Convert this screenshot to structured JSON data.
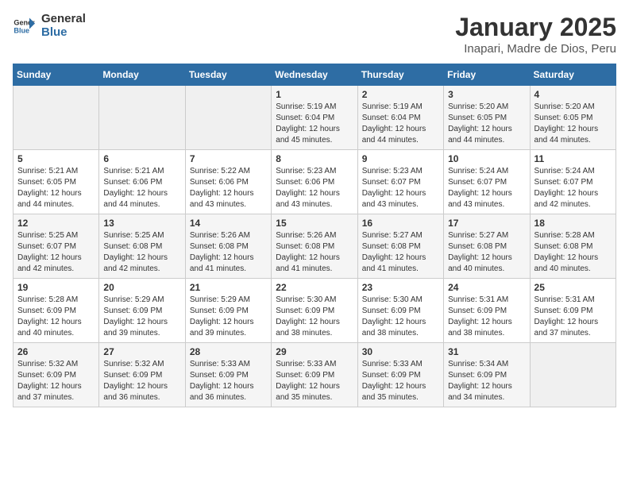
{
  "header": {
    "logo_general": "General",
    "logo_blue": "Blue",
    "title": "January 2025",
    "subtitle": "Inapari, Madre de Dios, Peru"
  },
  "days_of_week": [
    "Sunday",
    "Monday",
    "Tuesday",
    "Wednesday",
    "Thursday",
    "Friday",
    "Saturday"
  ],
  "weeks": [
    [
      {
        "day": "",
        "sunrise": "",
        "sunset": "",
        "daylight": "",
        "empty": true
      },
      {
        "day": "",
        "sunrise": "",
        "sunset": "",
        "daylight": "",
        "empty": true
      },
      {
        "day": "",
        "sunrise": "",
        "sunset": "",
        "daylight": "",
        "empty": true
      },
      {
        "day": "1",
        "sunrise": "Sunrise: 5:19 AM",
        "sunset": "Sunset: 6:04 PM",
        "daylight": "Daylight: 12 hours and 45 minutes."
      },
      {
        "day": "2",
        "sunrise": "Sunrise: 5:19 AM",
        "sunset": "Sunset: 6:04 PM",
        "daylight": "Daylight: 12 hours and 44 minutes."
      },
      {
        "day": "3",
        "sunrise": "Sunrise: 5:20 AM",
        "sunset": "Sunset: 6:05 PM",
        "daylight": "Daylight: 12 hours and 44 minutes."
      },
      {
        "day": "4",
        "sunrise": "Sunrise: 5:20 AM",
        "sunset": "Sunset: 6:05 PM",
        "daylight": "Daylight: 12 hours and 44 minutes."
      }
    ],
    [
      {
        "day": "5",
        "sunrise": "Sunrise: 5:21 AM",
        "sunset": "Sunset: 6:05 PM",
        "daylight": "Daylight: 12 hours and 44 minutes."
      },
      {
        "day": "6",
        "sunrise": "Sunrise: 5:21 AM",
        "sunset": "Sunset: 6:06 PM",
        "daylight": "Daylight: 12 hours and 44 minutes."
      },
      {
        "day": "7",
        "sunrise": "Sunrise: 5:22 AM",
        "sunset": "Sunset: 6:06 PM",
        "daylight": "Daylight: 12 hours and 43 minutes."
      },
      {
        "day": "8",
        "sunrise": "Sunrise: 5:23 AM",
        "sunset": "Sunset: 6:06 PM",
        "daylight": "Daylight: 12 hours and 43 minutes."
      },
      {
        "day": "9",
        "sunrise": "Sunrise: 5:23 AM",
        "sunset": "Sunset: 6:07 PM",
        "daylight": "Daylight: 12 hours and 43 minutes."
      },
      {
        "day": "10",
        "sunrise": "Sunrise: 5:24 AM",
        "sunset": "Sunset: 6:07 PM",
        "daylight": "Daylight: 12 hours and 43 minutes."
      },
      {
        "day": "11",
        "sunrise": "Sunrise: 5:24 AM",
        "sunset": "Sunset: 6:07 PM",
        "daylight": "Daylight: 12 hours and 42 minutes."
      }
    ],
    [
      {
        "day": "12",
        "sunrise": "Sunrise: 5:25 AM",
        "sunset": "Sunset: 6:07 PM",
        "daylight": "Daylight: 12 hours and 42 minutes."
      },
      {
        "day": "13",
        "sunrise": "Sunrise: 5:25 AM",
        "sunset": "Sunset: 6:08 PM",
        "daylight": "Daylight: 12 hours and 42 minutes."
      },
      {
        "day": "14",
        "sunrise": "Sunrise: 5:26 AM",
        "sunset": "Sunset: 6:08 PM",
        "daylight": "Daylight: 12 hours and 41 minutes."
      },
      {
        "day": "15",
        "sunrise": "Sunrise: 5:26 AM",
        "sunset": "Sunset: 6:08 PM",
        "daylight": "Daylight: 12 hours and 41 minutes."
      },
      {
        "day": "16",
        "sunrise": "Sunrise: 5:27 AM",
        "sunset": "Sunset: 6:08 PM",
        "daylight": "Daylight: 12 hours and 41 minutes."
      },
      {
        "day": "17",
        "sunrise": "Sunrise: 5:27 AM",
        "sunset": "Sunset: 6:08 PM",
        "daylight": "Daylight: 12 hours and 40 minutes."
      },
      {
        "day": "18",
        "sunrise": "Sunrise: 5:28 AM",
        "sunset": "Sunset: 6:08 PM",
        "daylight": "Daylight: 12 hours and 40 minutes."
      }
    ],
    [
      {
        "day": "19",
        "sunrise": "Sunrise: 5:28 AM",
        "sunset": "Sunset: 6:09 PM",
        "daylight": "Daylight: 12 hours and 40 minutes."
      },
      {
        "day": "20",
        "sunrise": "Sunrise: 5:29 AM",
        "sunset": "Sunset: 6:09 PM",
        "daylight": "Daylight: 12 hours and 39 minutes."
      },
      {
        "day": "21",
        "sunrise": "Sunrise: 5:29 AM",
        "sunset": "Sunset: 6:09 PM",
        "daylight": "Daylight: 12 hours and 39 minutes."
      },
      {
        "day": "22",
        "sunrise": "Sunrise: 5:30 AM",
        "sunset": "Sunset: 6:09 PM",
        "daylight": "Daylight: 12 hours and 38 minutes."
      },
      {
        "day": "23",
        "sunrise": "Sunrise: 5:30 AM",
        "sunset": "Sunset: 6:09 PM",
        "daylight": "Daylight: 12 hours and 38 minutes."
      },
      {
        "day": "24",
        "sunrise": "Sunrise: 5:31 AM",
        "sunset": "Sunset: 6:09 PM",
        "daylight": "Daylight: 12 hours and 38 minutes."
      },
      {
        "day": "25",
        "sunrise": "Sunrise: 5:31 AM",
        "sunset": "Sunset: 6:09 PM",
        "daylight": "Daylight: 12 hours and 37 minutes."
      }
    ],
    [
      {
        "day": "26",
        "sunrise": "Sunrise: 5:32 AM",
        "sunset": "Sunset: 6:09 PM",
        "daylight": "Daylight: 12 hours and 37 minutes."
      },
      {
        "day": "27",
        "sunrise": "Sunrise: 5:32 AM",
        "sunset": "Sunset: 6:09 PM",
        "daylight": "Daylight: 12 hours and 36 minutes."
      },
      {
        "day": "28",
        "sunrise": "Sunrise: 5:33 AM",
        "sunset": "Sunset: 6:09 PM",
        "daylight": "Daylight: 12 hours and 36 minutes."
      },
      {
        "day": "29",
        "sunrise": "Sunrise: 5:33 AM",
        "sunset": "Sunset: 6:09 PM",
        "daylight": "Daylight: 12 hours and 35 minutes."
      },
      {
        "day": "30",
        "sunrise": "Sunrise: 5:33 AM",
        "sunset": "Sunset: 6:09 PM",
        "daylight": "Daylight: 12 hours and 35 minutes."
      },
      {
        "day": "31",
        "sunrise": "Sunrise: 5:34 AM",
        "sunset": "Sunset: 6:09 PM",
        "daylight": "Daylight: 12 hours and 34 minutes."
      },
      {
        "day": "",
        "sunrise": "",
        "sunset": "",
        "daylight": "",
        "empty": true
      }
    ]
  ]
}
